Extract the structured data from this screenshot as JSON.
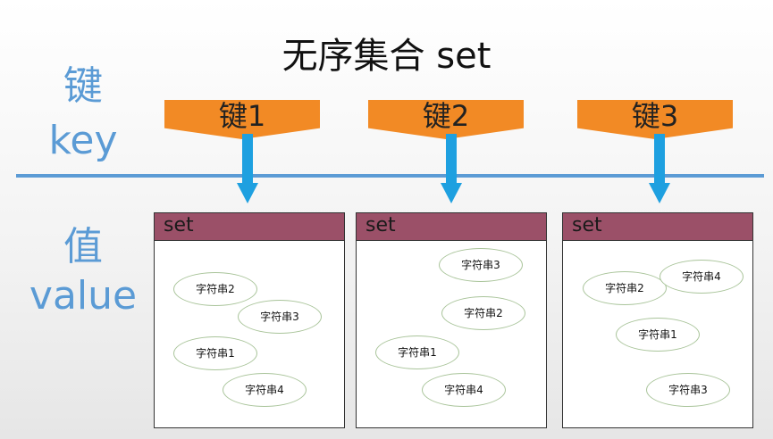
{
  "title": "无序集合 set",
  "left_labels": {
    "key_cn": "键",
    "key_en": "key",
    "value_cn": "值",
    "value_en": "value"
  },
  "keys": [
    "键1",
    "键2",
    "键3"
  ],
  "sets": [
    {
      "header": "set",
      "members": [
        "字符串2",
        "字符串3",
        "字符串1",
        "字符串4"
      ]
    },
    {
      "header": "set",
      "members": [
        "字符串3",
        "字符串2",
        "字符串1",
        "字符串4"
      ]
    },
    {
      "header": "set",
      "members": [
        "字符串2",
        "字符串4",
        "字符串1",
        "字符串3"
      ]
    }
  ],
  "colors": {
    "key": "#f28a25",
    "header": "#9b5068",
    "line": "#5b9bd5",
    "ellipse_border": "#a9c49a"
  }
}
